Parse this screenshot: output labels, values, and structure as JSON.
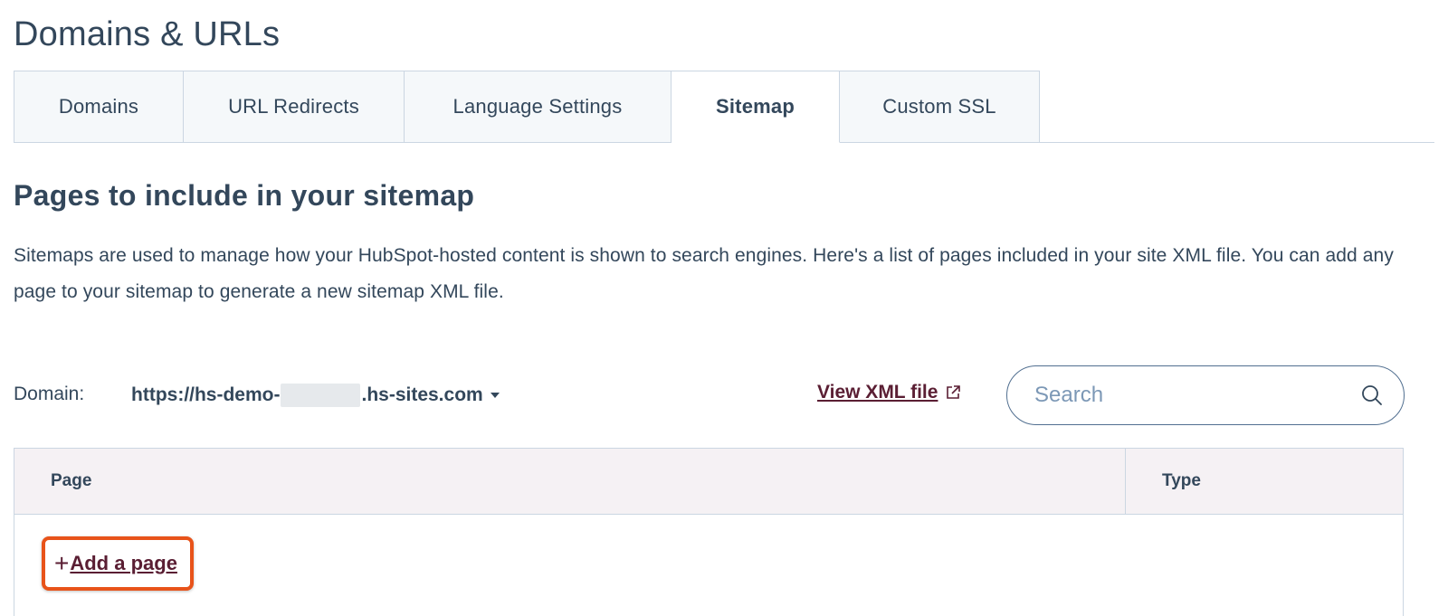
{
  "header": {
    "title": "Domains & URLs"
  },
  "tabs": [
    {
      "label": "Domains"
    },
    {
      "label": "URL Redirects"
    },
    {
      "label": "Language Settings"
    },
    {
      "label": "Sitemap",
      "active": true
    },
    {
      "label": "Custom SSL"
    }
  ],
  "section": {
    "heading": "Pages to include in your sitemap",
    "description": "Sitemaps are used to manage how your HubSpot-hosted content is shown to search engines. Here's a list of pages included in your site XML file. You can add any page to your sitemap to generate a new sitemap XML file."
  },
  "controls": {
    "domain_label": "Domain:",
    "domain_prefix": "https://hs-demo-",
    "domain_suffix": ".hs-sites.com",
    "view_xml_label": "View XML file",
    "search_placeholder": "Search"
  },
  "table": {
    "columns": [
      "Page",
      "Type"
    ],
    "add_page_label": "Add a page"
  },
  "colors": {
    "text": "#33475b",
    "link": "#5a1e33",
    "highlight": "#e8531a",
    "table_header_bg": "#f5f1f4",
    "tab_bg": "#f5f8fa",
    "border": "#cbd6e2"
  },
  "icons": {
    "external_link": "external-link-icon",
    "search": "search-icon",
    "dropdown": "caret-down-icon",
    "add": "plus-icon"
  }
}
